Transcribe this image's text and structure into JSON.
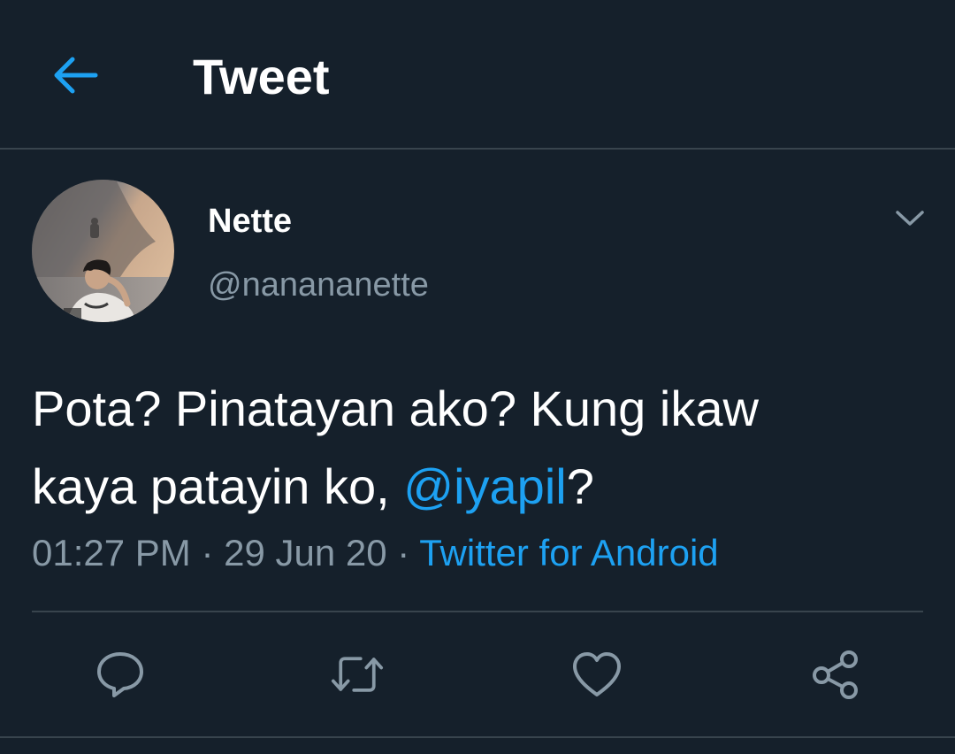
{
  "header": {
    "title": "Tweet",
    "back_icon": "arrow-left-icon",
    "accent_color": "#1da1f2"
  },
  "author": {
    "name": "Nette",
    "handle": "@nanananette"
  },
  "tweet": {
    "line1": "Pota? Pinatayan ako? Kung ikaw",
    "line2_prefix": "kaya patayin ko, ",
    "mention": "@iyapil",
    "line2_suffix": "?"
  },
  "meta": {
    "time": "01:27 PM",
    "separator": " · ",
    "date": "29 Jun 20",
    "source": "Twitter for Android"
  },
  "actions": {
    "reply_icon": "reply-icon",
    "retweet_icon": "retweet-icon",
    "like_icon": "heart-icon",
    "share_icon": "share-icon"
  },
  "colors": {
    "background": "#15202b",
    "text": "#ffffff",
    "secondary": "#8899a6",
    "link": "#1da1f2",
    "divider": "#38444d"
  }
}
